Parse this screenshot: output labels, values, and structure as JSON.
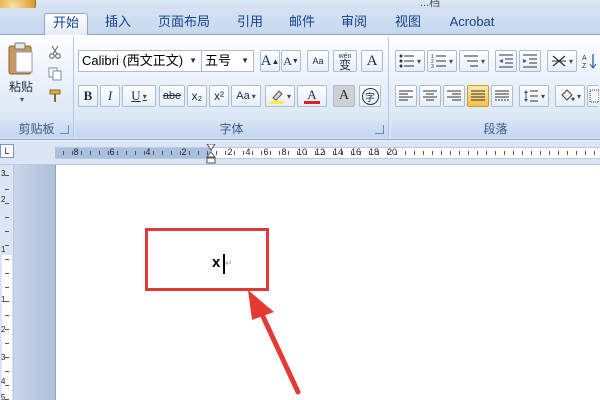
{
  "window": {
    "title": "...档"
  },
  "tabs": [
    {
      "label": "开始",
      "active": true
    },
    {
      "label": "插入"
    },
    {
      "label": "页面布局"
    },
    {
      "label": "引用"
    },
    {
      "label": "邮件"
    },
    {
      "label": "审阅"
    },
    {
      "label": "视图"
    },
    {
      "label": "Acrobat"
    }
  ],
  "clipboard": {
    "paste_label": "粘贴",
    "group_label": "剪贴板"
  },
  "font_group": {
    "font_name": "Calibri (西文正文)",
    "font_size": "五号",
    "grow_label": "A",
    "shrink_label": "A",
    "bold": "B",
    "italic": "I",
    "underline": "U",
    "strike": "abe",
    "subscript": "x₂",
    "superscript": "x²",
    "aa_label": "Aa",
    "font_color_label": "A",
    "char_shade_label": "A",
    "enclose_label": "字",
    "phonetic_label": "wén",
    "phonetic_char": "变",
    "border_label": "A",
    "group_label": "字体",
    "highlight_color": "#ffef3b",
    "font_color": "#e02020"
  },
  "paragraph_group": {
    "group_label": "段落"
  },
  "ruler": {
    "corner": "L",
    "labels_left": [
      "8",
      "6",
      "4",
      "2"
    ],
    "labels_right": [
      "2",
      "4",
      "6",
      "8",
      "10",
      "12",
      "14",
      "16",
      "18",
      "20"
    ]
  },
  "vruler": {
    "labels": [
      "3",
      "2",
      "1",
      "1",
      "2",
      "3",
      "4",
      "5"
    ]
  },
  "document": {
    "text": "x",
    "para_mark": "↵"
  },
  "colors": {
    "annotation_red": "#e53935"
  }
}
